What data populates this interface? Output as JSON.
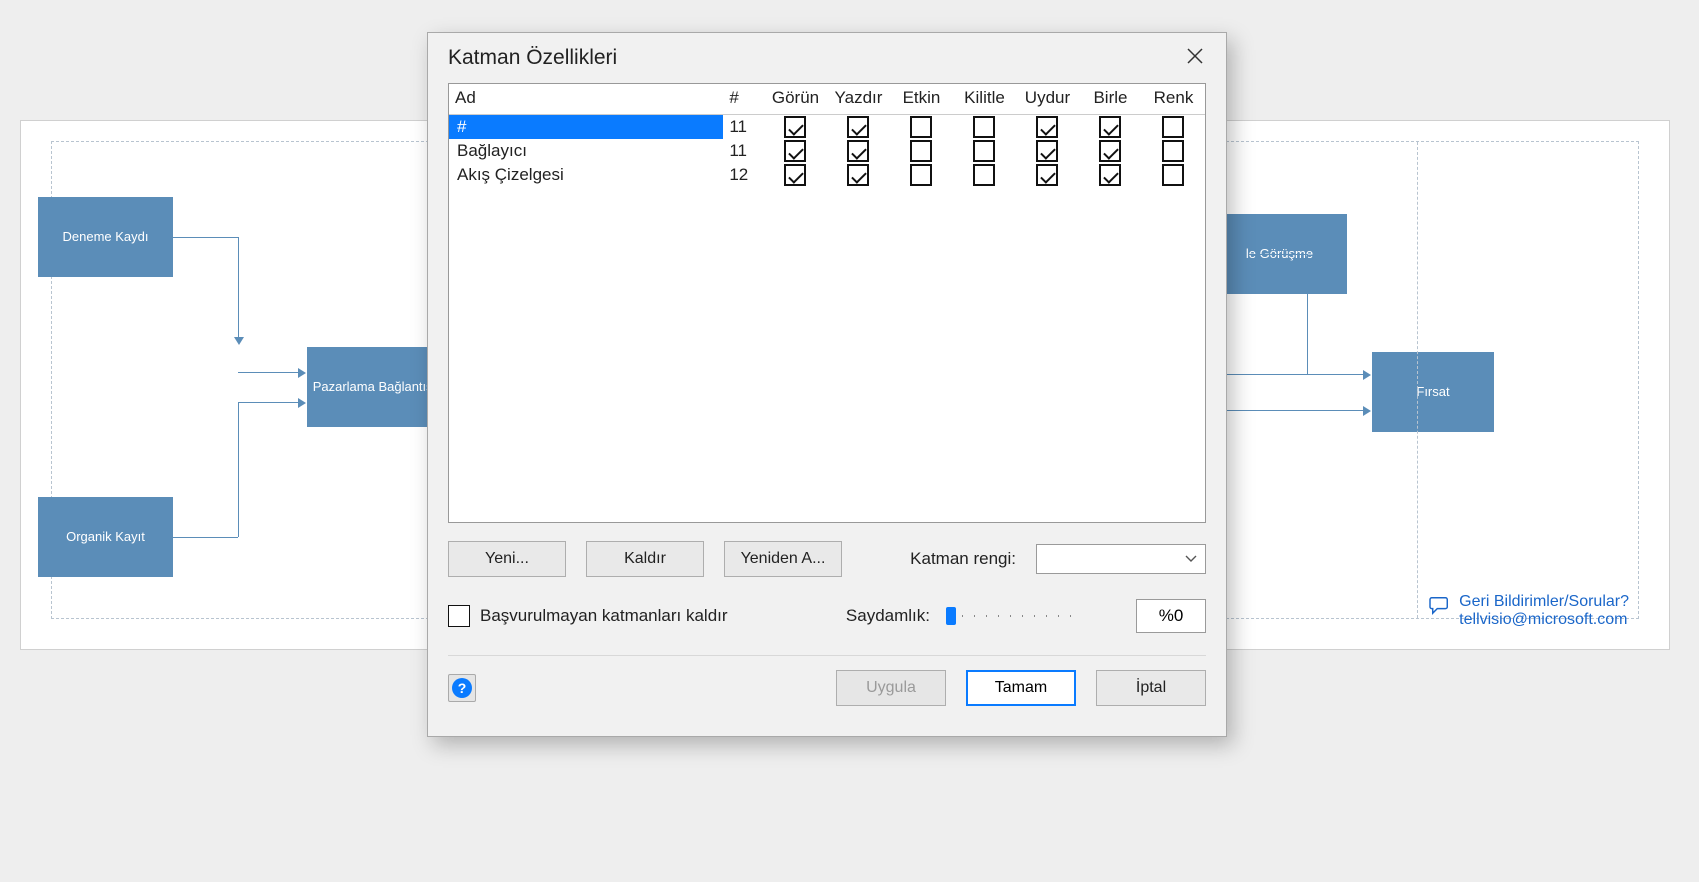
{
  "canvas": {
    "nodes": {
      "trial": "Deneme Kaydı",
      "organic": "Organik Kayıt",
      "marketing": "Pazarlama Bağlantısı",
      "meeting": "le Görüşme",
      "opportunity": "Fırsat"
    },
    "feedback": {
      "line1": "Geri Bildirimler/Sorular?",
      "line2": "tellvisio@microsoft.com"
    }
  },
  "dialog": {
    "title": "Katman Özellikleri",
    "columns": {
      "name": "Ad",
      "count": "#",
      "visible": "Görün",
      "print": "Yazdır",
      "active": "Etkin",
      "lock": "Kilitle",
      "snap": "Uydur",
      "glue": "Birle",
      "color": "Renk"
    },
    "rows": [
      {
        "name": "#",
        "count": "11",
        "visible": true,
        "print": true,
        "active": false,
        "lock": false,
        "snap": true,
        "glue": true,
        "color": false,
        "selected": true
      },
      {
        "name": "Bağlayıcı",
        "count": "11",
        "visible": true,
        "print": true,
        "active": false,
        "lock": false,
        "snap": true,
        "glue": true,
        "color": false,
        "selected": false
      },
      {
        "name": "Akış Çizelgesi",
        "count": "12",
        "visible": true,
        "print": true,
        "active": false,
        "lock": false,
        "snap": true,
        "glue": true,
        "color": false,
        "selected": false
      }
    ],
    "buttons": {
      "new": "Yeni...",
      "remove": "Kaldır",
      "rename": "Yeniden A..."
    },
    "layer_color_label": "Katman rengi:",
    "remove_unref_label": "Başvurulmayan katmanları kaldır",
    "transparency_label": "Saydamlık:",
    "transparency_value": "%0",
    "footer": {
      "apply": "Uygula",
      "ok": "Tamam",
      "cancel": "İptal"
    }
  }
}
